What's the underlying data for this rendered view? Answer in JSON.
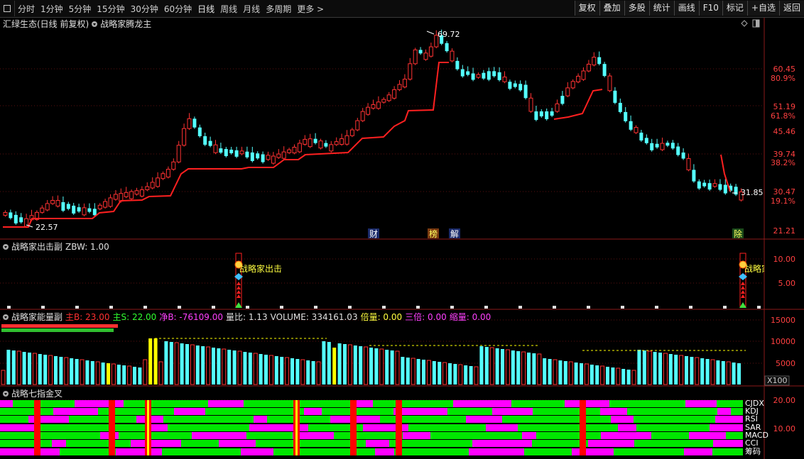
{
  "toolbar": {
    "left_items": [
      "分时",
      "1分钟",
      "5分钟",
      "15分钟",
      "30分钟",
      "60分钟",
      "日线",
      "周线",
      "月线",
      "多周期"
    ],
    "more": "更多",
    "right_buttons": [
      "复权",
      "叠加",
      "多股",
      "统计",
      "画线",
      "F10",
      "标记",
      "+自选",
      "返回"
    ]
  },
  "main_panel": {
    "stock_label": "汇绿生态(日线 前复权)",
    "indicator": "战略家腾龙主",
    "price_axis": [
      "60.45",
      "80.9%",
      "51.19",
      "61.8%",
      "45.46",
      "39.74",
      "38.2%",
      "30.47",
      "19.1%",
      "21.21"
    ],
    "high_label": "69.72",
    "low_label": "22.57",
    "last_label": "31.85",
    "event_tags": [
      "财",
      "榜",
      "解",
      "除"
    ]
  },
  "sub1": {
    "title": "战略家出击副",
    "param": "ZBW: 1.00",
    "signal_text": "战略家出击",
    "signal_text_clipped": "战略家",
    "axis": [
      "10.00",
      "5.00"
    ]
  },
  "sub2": {
    "title": "战略家能量副",
    "main_b": "主B: 23.00",
    "main_s": "主S: 22.00",
    "net_b": "净B: -76109.00",
    "vol_ratio": "量比: 1.13",
    "volume": "VOLUME: 334161.03",
    "double": "倍量: 0.00",
    "triple": "三倍: 0.00",
    "shrink": "缩量: 0.00",
    "axis": [
      "15000",
      "10000",
      "5000"
    ],
    "unit": "X100"
  },
  "sub3": {
    "title": "战略七指金叉",
    "axis": [
      "20.00",
      "10.00"
    ],
    "row_labels": [
      "CJDX",
      "KDJ",
      "RSI",
      "SAR",
      "MACD",
      "CCI",
      "筹码"
    ]
  },
  "colors": {
    "up": "#ff3232",
    "down": "#54ffff",
    "line": "#ff2020",
    "green": "#00e600",
    "magenta": "#ff00ff",
    "yellow": "#ffff00"
  },
  "icons": {
    "menu": "menu-icon",
    "more": "chevron-right-icon",
    "collapse": "collapse-icon"
  }
}
